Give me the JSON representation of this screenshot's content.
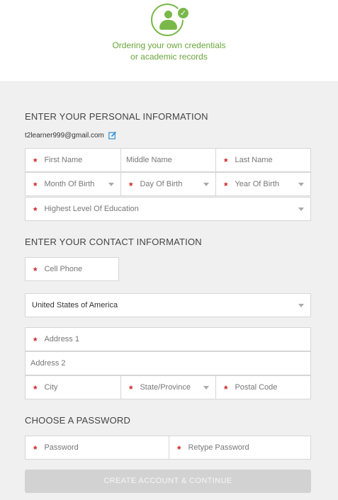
{
  "header": {
    "subtitle_line1": "Ordering your own credentials",
    "subtitle_line2": "or academic records",
    "accent_color": "#7ab84a",
    "icon": "person-check-icon"
  },
  "personal": {
    "title": "ENTER YOUR PERSONAL INFORMATION",
    "email": "t2learner999@gmail.com",
    "first_name": "First Name",
    "middle_name": "Middle Name",
    "last_name": "Last Name",
    "month_of_birth": "Month Of Birth",
    "day_of_birth": "Day Of Birth",
    "year_of_birth": "Year Of Birth",
    "education": "Highest Level Of Education"
  },
  "contact": {
    "title": "ENTER YOUR CONTACT INFORMATION",
    "cell_phone": "Cell Phone",
    "country": "United States of America",
    "address1": "Address 1",
    "address2": "Address 2",
    "city": "City",
    "state": "State/Province",
    "postal": "Postal Code"
  },
  "password": {
    "title": "CHOOSE A PASSWORD",
    "password": "Password",
    "retype": "Retype Password"
  },
  "submit": {
    "label": "CREATE ACCOUNT & CONTINUE"
  },
  "colors": {
    "required": "#c92a2a",
    "button_disabled": "#d2d2d2"
  }
}
